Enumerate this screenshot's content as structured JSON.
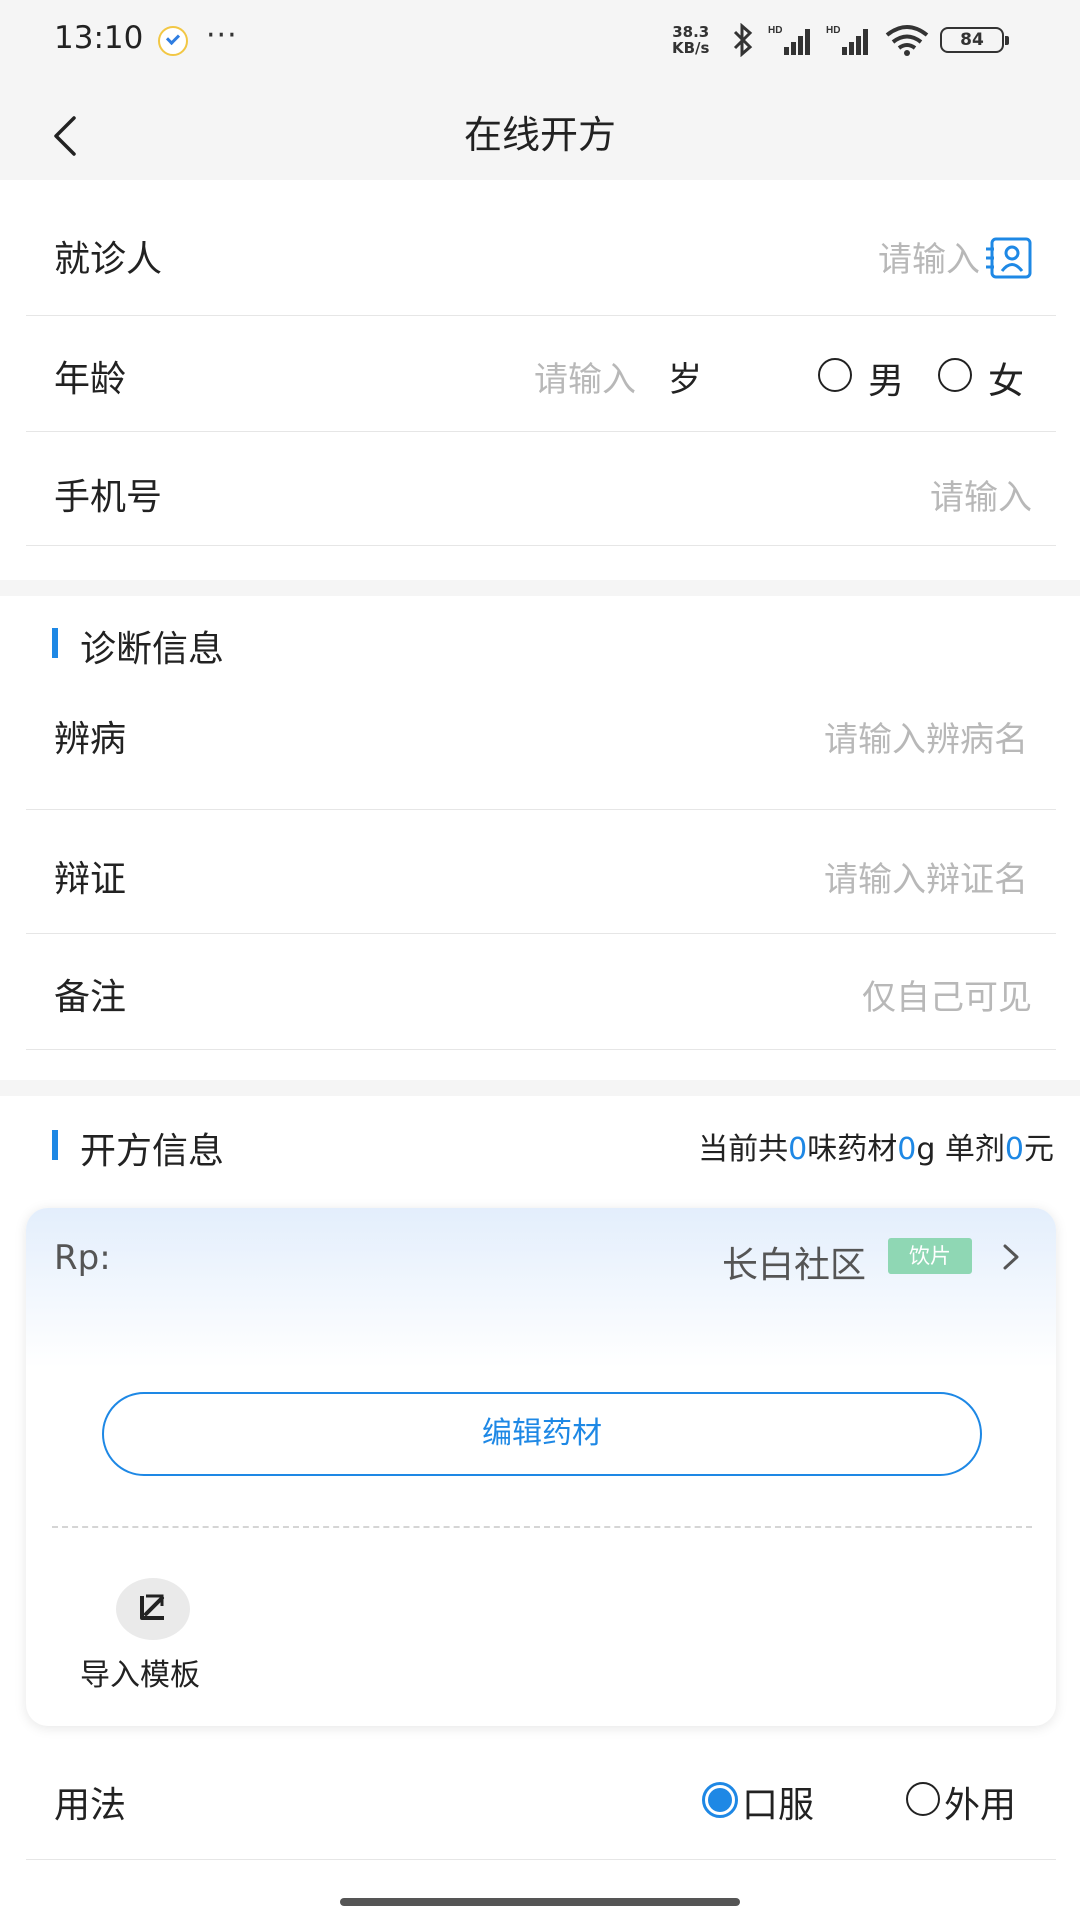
{
  "status_bar": {
    "time": "13:10",
    "more": "···",
    "net_speed_value": "38.3",
    "net_speed_unit": "KB/s",
    "battery": "84"
  },
  "nav": {
    "title": "在线开方"
  },
  "patient": {
    "name_label": "就诊人",
    "name_placeholder": "请输入",
    "age_label": "年龄",
    "age_placeholder": "请输入",
    "age_unit": "岁",
    "gender_male": "男",
    "gender_female": "女",
    "phone_label": "手机号",
    "phone_placeholder": "请输入"
  },
  "diagnosis": {
    "title": "诊断信息",
    "disease_label": "辨病",
    "disease_placeholder": "请输入辨病名",
    "syndrome_label": "辩证",
    "syndrome_placeholder": "请输入辩证名",
    "remark_label": "备注",
    "remark_placeholder": "仅自己可见"
  },
  "prescription": {
    "title": "开方信息",
    "summary_prefix": "当前共",
    "herb_count": "0",
    "summary_mid1": "味药材",
    "total_grams": "0",
    "summary_mid2": "g 单剂",
    "price": "0",
    "summary_suffix": "元",
    "rp_label": "Rp:",
    "pharmacy": "长白社区",
    "badge": "饮片",
    "edit_button": "编辑药材",
    "import_template": "导入模板"
  },
  "usage": {
    "label": "用法",
    "option_oral": "口服",
    "option_external": "外用",
    "selected": "口服"
  },
  "colors": {
    "accent": "#1e88e5",
    "badge": "#8fd7b4",
    "placeholder": "#b8b8b8"
  },
  "icons": [
    "back-arrow-icon",
    "contact-card-icon",
    "chevron-right-icon",
    "import-template-icon",
    "bluetooth-icon",
    "signal-icon",
    "wifi-icon",
    "battery-icon"
  ]
}
